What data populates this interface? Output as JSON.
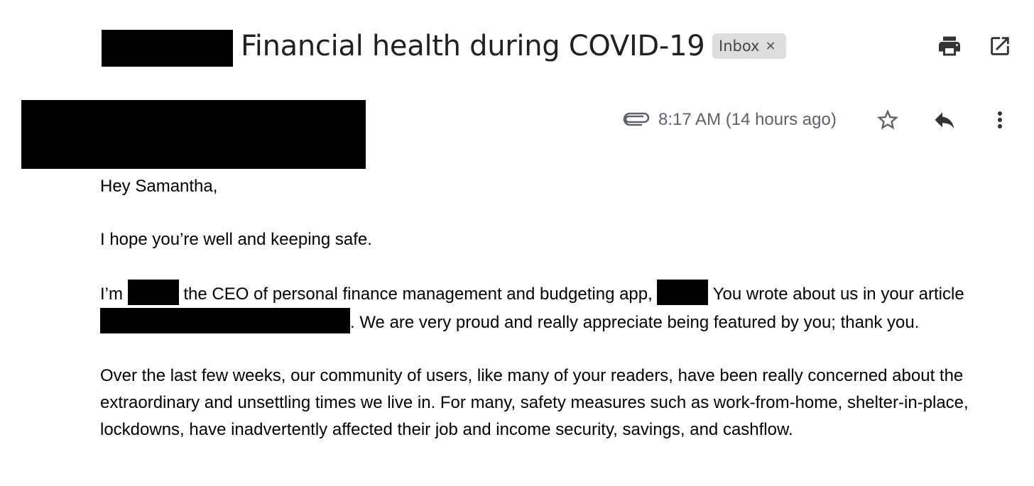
{
  "header": {
    "subject": "Financial health during COVID-19",
    "label_chip": "Inbox",
    "label_remove_glyph": "×",
    "actions": [
      {
        "icon": "print-icon"
      },
      {
        "icon": "open-in-new-window-icon"
      }
    ]
  },
  "message_meta": {
    "attachment_icon": "paperclip-icon",
    "timestamp": "8:17 AM (14 hours ago)",
    "actions": [
      {
        "icon": "star-icon"
      },
      {
        "icon": "reply-icon"
      },
      {
        "icon": "more-vert-icon"
      }
    ]
  },
  "body": {
    "greeting": "Hey Samantha,",
    "p1": "I hope you’re well and keeping safe.",
    "p2": {
      "a": "I’m ",
      "b": " the CEO of personal finance management and budgeting app,",
      "c": " You wrote about us in your article ",
      "d": ". We are very proud and really appreciate being featured by you; thank you."
    },
    "p3": "Over the last few weeks, our community of users, like many of your readers, have been really concerned about the extraordinary and unsettling times we live in. For many, safety measures such as work-from-home, shelter-in-place, lockdowns, have inadvertently affected their job and income security, savings, and cashflow."
  },
  "colors": {
    "text": "#000000",
    "subject": "#202124",
    "meta": "#5f6368",
    "chip_bg": "#dddddd",
    "icon": "#444746"
  }
}
